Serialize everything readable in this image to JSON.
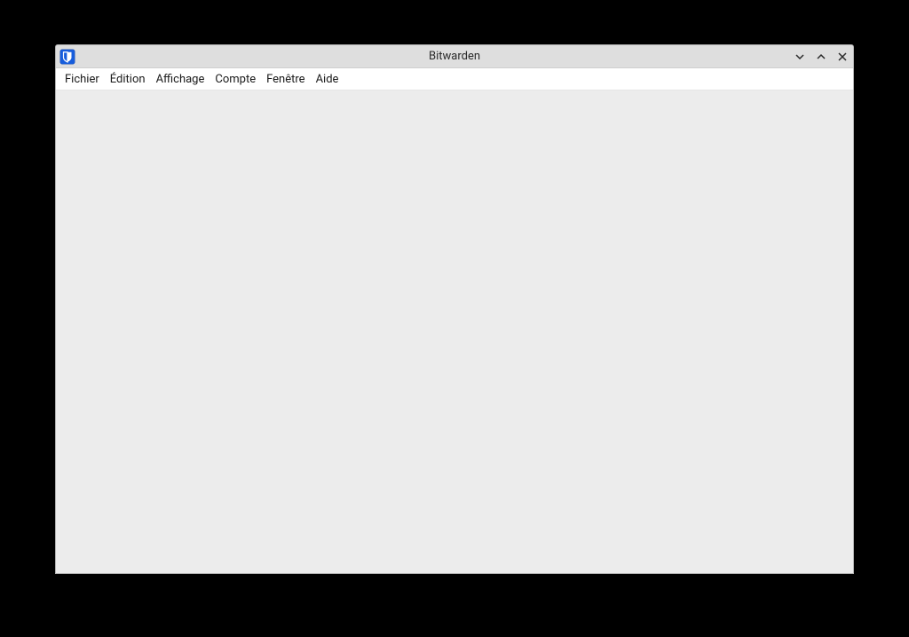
{
  "window": {
    "title": "Bitwarden"
  },
  "menubar": {
    "items": [
      {
        "label": "Fichier"
      },
      {
        "label": "Édition"
      },
      {
        "label": "Affichage"
      },
      {
        "label": "Compte"
      },
      {
        "label": "Fenêtre"
      },
      {
        "label": "Aide"
      }
    ]
  }
}
